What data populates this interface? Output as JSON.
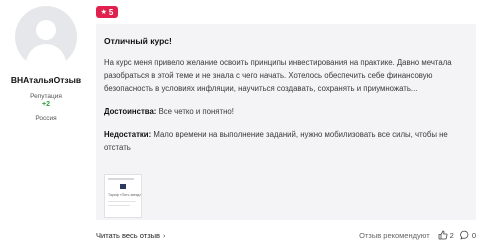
{
  "user": {
    "name": "ВНАтальяОтзыв",
    "reputation_label": "Репутация",
    "reputation_value": "+2",
    "country": "Россия"
  },
  "rating": {
    "value": "5",
    "max": 5,
    "color": "#e0204d"
  },
  "review": {
    "title": "Отличный курс!",
    "body": "На курс меня привело желание освоить принципы инвестирования на практике. Давно мечтала разобраться в этой теме и не знала с чего начать. Хотелось обеспечить себе финансовую безопасность в условиях инфляции, научиться создавать, сохранять и приумножать...",
    "pros_label": "Достоинства:",
    "pros_text": "Все четко и понятно!",
    "cons_label": "Недостатки:",
    "cons_text": "Мало времени на выполнение заданий, нужно мобилизовать все силы, чтобы не отстать"
  },
  "attachment": {
    "caption": "Тариф «Пять звезд»"
  },
  "footer": {
    "read_all": "Читать весь отзыв",
    "read_all_chevron": "›",
    "recommended": "Отзыв рекомендуют",
    "likes": "2",
    "comments": "0"
  },
  "icons": [
    "avatar-placeholder-icon",
    "star-icon",
    "chevron-right-icon",
    "thumbs-up-icon",
    "comment-icon"
  ]
}
